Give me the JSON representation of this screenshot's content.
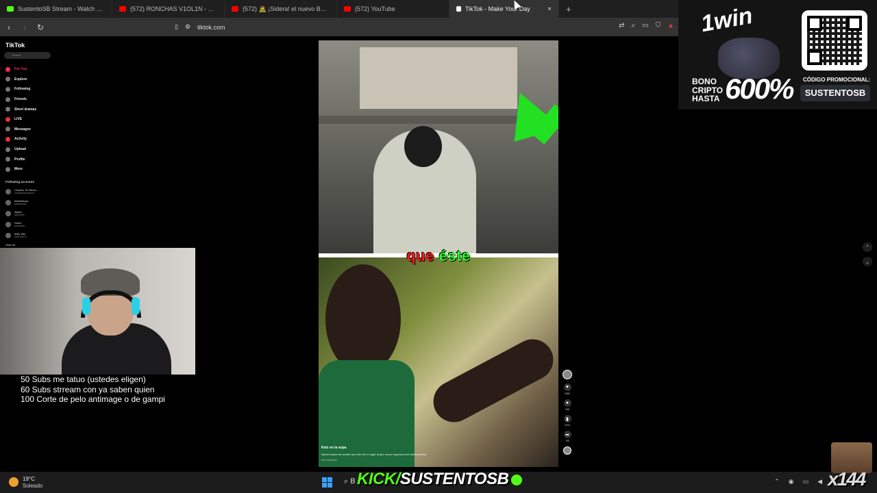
{
  "browser": {
    "tabs": [
      {
        "title": "SustentoSB Stream - Watch Live on K",
        "color": "#53fc18"
      },
      {
        "title": "(572) RONCHAS V1OL1N - PIURANO",
        "color": "#ff0000"
      },
      {
        "title": "(572) 🧟 ¡Sidera! el nuevo BELLA LU",
        "color": "#ff0000"
      },
      {
        "title": "(572) YouTube",
        "color": "#ff0000"
      },
      {
        "title": "TikTok - Make Your Day",
        "color": "#ffffff"
      }
    ],
    "new_tab": "+",
    "close_tab": "×",
    "url": "tiktok.com"
  },
  "tiktok": {
    "logo": "TikTok",
    "search_placeholder": "Search",
    "nav": [
      {
        "label": "For You",
        "active": true
      },
      {
        "label": "Explore"
      },
      {
        "label": "Following"
      },
      {
        "label": "Friends"
      },
      {
        "label": "Short dramas"
      },
      {
        "label": "LIVE"
      },
      {
        "label": "Messages"
      },
      {
        "label": "Activity"
      },
      {
        "label": "Upload"
      },
      {
        "label": "Profile"
      },
      {
        "label": "More"
      }
    ],
    "following_heading": "Following accounts",
    "accounts": [
      {
        "name": "Charles \"Ilo Rincn...",
        "handle": "charlesiloloreincon"
      },
      {
        "name": "barbellmaa",
        "handle": "barbellmaa"
      },
      {
        "name": "Alyxis",
        "handle": "alyxis999"
      },
      {
        "name": "Ocelo",
        "handle": "peoplocel..."
      },
      {
        "name": "belle elle",
        "handle": "belle.elle74"
      }
    ],
    "view_all": "View all"
  },
  "video": {
    "caption_word1": "que",
    "caption_word2": "éste",
    "author": "Ketz en la sopa",
    "description": "Speed acaba de admitir que éste fue el lugar al que nunca regresaría de latinoamérica",
    "see_translation": "See translation",
    "likes": "308K",
    "comments": "468",
    "saves": "3204",
    "shares": "765"
  },
  "overlay": {
    "goals": [
      "50 Subs me tatuo (ustedes eligen)",
      "60 Subs strream con ya saben quien",
      "100 Corte de pelo antimage o de gampi"
    ],
    "promo": {
      "logo": "1win",
      "bono_lines": [
        "BONO",
        "CRIPTO",
        "HASTA"
      ],
      "percent": "600%",
      "code_label": "CÓDIGO PROMOCIONAL:",
      "code": "SUSTENTOSB"
    },
    "kick_a": "KICK/",
    "kick_b": "SUSTENTOSB",
    "multiplier": "x144"
  },
  "taskbar": {
    "temp": "19°C",
    "condition": "Soleado",
    "search_label": "B"
  }
}
